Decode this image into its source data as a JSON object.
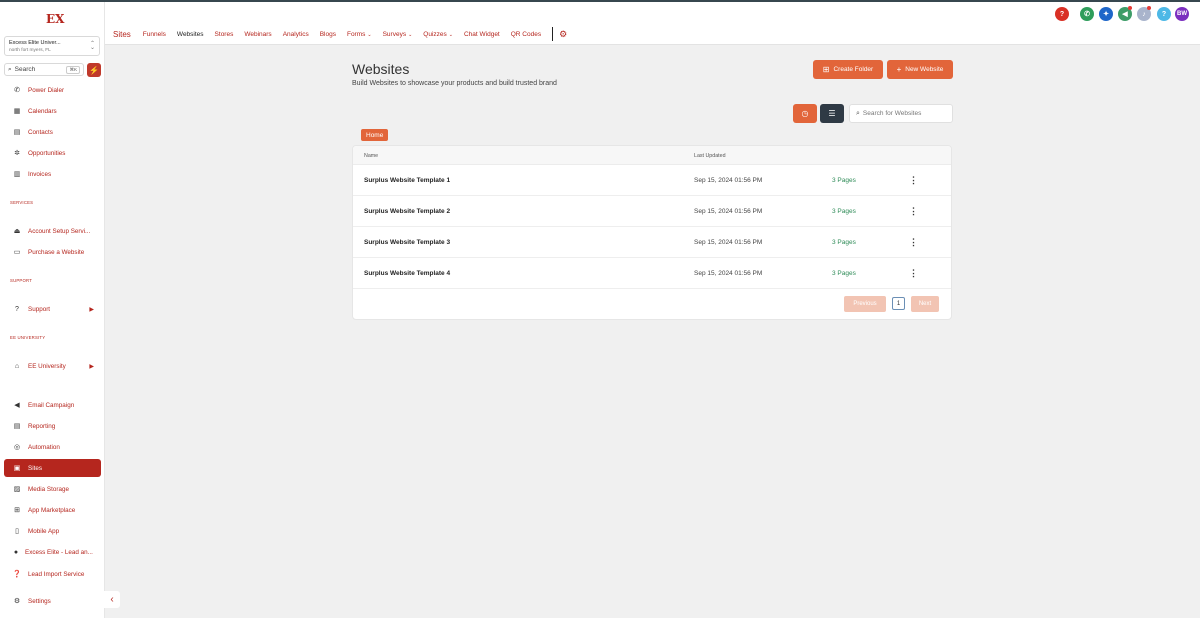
{
  "sidebar": {
    "account_name": "Excess Elite Univer...",
    "account_location": "north fort myers, FL",
    "search_label": "Search",
    "search_shortcut": "⌘K",
    "items": [
      {
        "label": "Power Dialer",
        "icon": "phone-icon"
      },
      {
        "label": "Calendars",
        "icon": "calendar-icon"
      },
      {
        "label": "Contacts",
        "icon": "contacts-icon"
      },
      {
        "label": "Opportunities",
        "icon": "opportunities-icon"
      },
      {
        "label": "Invoices",
        "icon": "invoice-icon"
      },
      {
        "label": "Account Setup Servi...",
        "icon": "setup-icon"
      },
      {
        "label": "Purchase a Website",
        "icon": "monitor-icon"
      },
      {
        "label": "Support",
        "icon": "question-icon"
      },
      {
        "label": "EE University",
        "icon": "university-icon"
      },
      {
        "label": "Email Campaign",
        "icon": "megaphone-icon"
      },
      {
        "label": "Reporting",
        "icon": "reporting-icon"
      },
      {
        "label": "Automation",
        "icon": "automation-icon"
      },
      {
        "label": "Sites",
        "icon": "sites-icon"
      },
      {
        "label": "Media Storage",
        "icon": "media-icon"
      },
      {
        "label": "App Marketplace",
        "icon": "grid-icon"
      },
      {
        "label": "Mobile App",
        "icon": "mobile-icon"
      },
      {
        "label": "Excess Elite - Lead an...",
        "icon": "user-icon"
      },
      {
        "label": "Lead Import Service",
        "icon": "help-circle-icon"
      },
      {
        "label": "Settings",
        "icon": "gear-icon"
      }
    ],
    "sections": {
      "services": "SERVICES",
      "support": "SUPPORT",
      "university": "EE UNIVERSITY"
    }
  },
  "topnav": {
    "title": "Sites",
    "tabs": [
      "Funnels",
      "Websites",
      "Stores",
      "Webinars",
      "Analytics",
      "Blogs",
      "Forms",
      "Surveys",
      "Quizzes",
      "Chat Widget",
      "QR Codes"
    ]
  },
  "header": {
    "avatar_initials": "BW"
  },
  "main": {
    "title": "Websites",
    "subtitle": "Build Websites to showcase your products and build trusted brand",
    "create_folder": "Create Folder",
    "new_website": "New Website",
    "search_placeholder": "Search for Websites",
    "breadcrumb": "Home",
    "columns": {
      "name": "Name",
      "updated": "Last Updated"
    },
    "rows": [
      {
        "name": "Surplus Website Template 1",
        "updated": "Sep 15, 2024 01:56 PM",
        "pages": "3 Pages"
      },
      {
        "name": "Surplus Website Template 2",
        "updated": "Sep 15, 2024 01:56 PM",
        "pages": "3 Pages"
      },
      {
        "name": "Surplus Website Template 3",
        "updated": "Sep 15, 2024 01:56 PM",
        "pages": "3 Pages"
      },
      {
        "name": "Surplus Website Template 4",
        "updated": "Sep 15, 2024 01:56 PM",
        "pages": "3 Pages"
      }
    ],
    "pagination": {
      "previous": "Previous",
      "page": "1",
      "next": "Next"
    }
  },
  "colors": {
    "brand": "#b5261e",
    "accent": "#e2653a",
    "pages_green": "#2e8b57"
  }
}
